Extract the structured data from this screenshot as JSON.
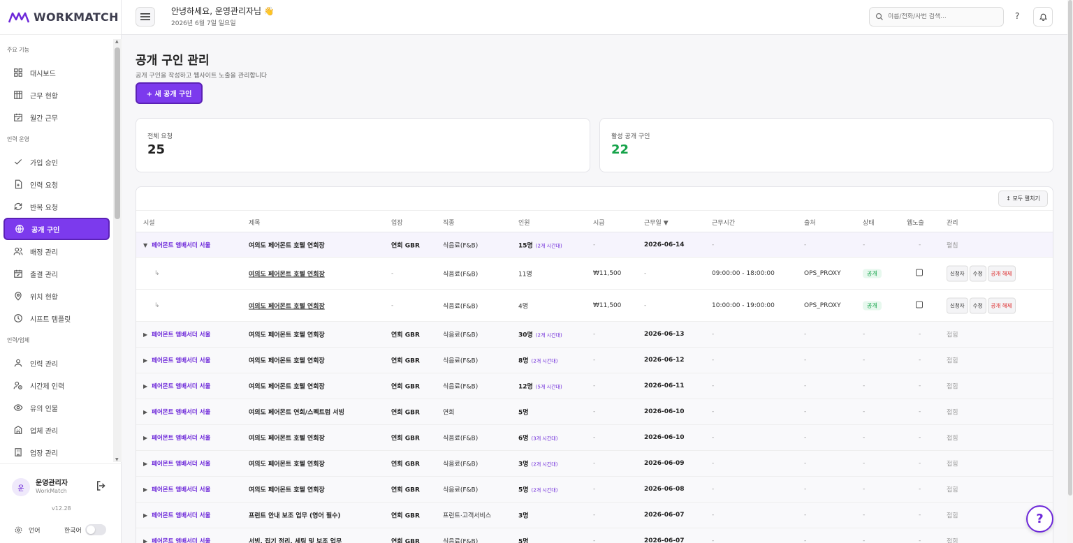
{
  "brand": {
    "logo_text": "WORKMATCH",
    "accent": "#7c3aed"
  },
  "sidebar": {
    "sections": [
      {
        "title": "주요 기능",
        "items": [
          {
            "label": "대시보드",
            "icon": "grid-icon"
          },
          {
            "label": "근무 현황",
            "icon": "table-icon"
          },
          {
            "label": "월간 근무",
            "icon": "calendar-check-icon"
          }
        ]
      },
      {
        "title": "인력 운영",
        "items": [
          {
            "label": "가입 승인",
            "icon": "check-icon"
          },
          {
            "label": "인력 요청",
            "icon": "file-plus-icon"
          },
          {
            "label": "반복 요청",
            "icon": "repeat-icon"
          },
          {
            "label": "공개 구인",
            "icon": "globe-icon",
            "active": true
          },
          {
            "label": "배정 관리",
            "icon": "users-icon"
          },
          {
            "label": "출결 관리",
            "icon": "calendar-check-icon"
          },
          {
            "label": "위치 현황",
            "icon": "map-pin-icon"
          },
          {
            "label": "시프트 템플릿",
            "icon": "clock-icon"
          }
        ]
      },
      {
        "title": "인력/업체",
        "items": [
          {
            "label": "인력 관리",
            "icon": "user-icon"
          },
          {
            "label": "시간제 인력",
            "icon": "user-clock-icon"
          },
          {
            "label": "유의 인물",
            "icon": "eye-icon"
          },
          {
            "label": "업체 관리",
            "icon": "building-icon"
          },
          {
            "label": "업장 관리",
            "icon": "store-icon"
          }
        ]
      }
    ],
    "user": {
      "avatar": "운",
      "name": "운영관리자",
      "org": "WorkMatch"
    },
    "version": "v12.28",
    "language_label": "언어",
    "language_value": "한국어"
  },
  "header": {
    "greeting": "안녕하세요, 운영관리자님 👋",
    "date": "2026년 6월 7일 일요일",
    "search_placeholder": "이름/전화/사번 검색...",
    "help": "?"
  },
  "page": {
    "title": "공개 구인 관리",
    "subtitle": "공개 구인을 작성하고 웹사이트 노출을 관리합니다",
    "new_button": "+ 새 공개 구인",
    "stats": [
      {
        "label": "전체 요청",
        "value": "25",
        "color": "#222222"
      },
      {
        "label": "활성 공개 구인",
        "value": "22",
        "color": "#16a34a"
      }
    ],
    "expand_all": "↕ 모두 펼치기"
  },
  "table": {
    "columns": [
      "시설",
      "제목",
      "업장",
      "직종",
      "인원",
      "시급",
      "근무일 ▼",
      "근무시간",
      "출처",
      "상태",
      "웹노출",
      "관리"
    ],
    "rows": [
      {
        "type": "group",
        "open": true,
        "caret": "▼",
        "facility": "페어몬트 앰배서더 서울",
        "title": "여의도 페어몬트 호텔 연회장",
        "venue": "연회 GBR",
        "job": "식음료(F&B)",
        "count": "15명",
        "slots": "(2개 시간대)",
        "wage": "-",
        "date": "2026-06-14",
        "time": "-",
        "source": "-",
        "status": "-",
        "web": "-",
        "manage": "펼침"
      },
      {
        "type": "child",
        "arrow": "↳",
        "title": "여의도 페어몬트 호텔 연회장",
        "venue": "-",
        "job": "식음료(F&B)",
        "count": "11명",
        "wage": "₩11,500",
        "date": "-",
        "time": "09:00:00 - 18:00:00",
        "source": "OPS_PROXY",
        "status": "공개",
        "actions": [
          "신청자",
          "수정",
          "공개 해제"
        ]
      },
      {
        "type": "child",
        "arrow": "↳",
        "title": "여의도 페어몬트 호텔 연회장",
        "venue": "-",
        "job": "식음료(F&B)",
        "count": "4명",
        "wage": "₩11,500",
        "date": "-",
        "time": "10:00:00 - 19:00:00",
        "source": "OPS_PROXY",
        "status": "공개",
        "actions": [
          "신청자",
          "수정",
          "공개 해제"
        ]
      },
      {
        "type": "group",
        "caret": "▶",
        "facility": "페어몬트 앰배서더 서울",
        "title": "여의도 페어몬트 호텔 연회장",
        "venue": "연회 GBR",
        "job": "식음료(F&B)",
        "count": "30명",
        "slots": "(2개 시간대)",
        "wage": "-",
        "date": "2026-06-13",
        "time": "-",
        "source": "-",
        "status": "-",
        "web": "-",
        "manage": "접힘"
      },
      {
        "type": "group",
        "caret": "▶",
        "facility": "페어몬트 앰배서더 서울",
        "title": "여의도 페어몬트 호텔 연회장",
        "venue": "연회 GBR",
        "job": "식음료(F&B)",
        "count": "8명",
        "slots": "(2개 시간대)",
        "wage": "-",
        "date": "2026-06-12",
        "time": "-",
        "source": "-",
        "status": "-",
        "web": "-",
        "manage": "접힘"
      },
      {
        "type": "group",
        "caret": "▶",
        "facility": "페어몬트 앰배서더 서울",
        "title": "여의도 페어몬트 호텔 연회장",
        "venue": "연회 GBR",
        "job": "식음료(F&B)",
        "count": "12명",
        "slots": "(5개 시간대)",
        "wage": "-",
        "date": "2026-06-11",
        "time": "-",
        "source": "-",
        "status": "-",
        "web": "-",
        "manage": "접힘"
      },
      {
        "type": "group",
        "caret": "▶",
        "facility": "페어몬트 앰배서더 서울",
        "title": "여의도 페어몬트 연회/스펙트럼 서빙",
        "venue": "연회 GBR",
        "job": "연회",
        "count": "5명",
        "slots": "",
        "wage": "-",
        "date": "2026-06-10",
        "time": "-",
        "source": "-",
        "status": "-",
        "web": "-",
        "manage": "접힘"
      },
      {
        "type": "group",
        "caret": "▶",
        "facility": "페어몬트 앰배서더 서울",
        "title": "여의도 페어몬트 호텔 연회장",
        "venue": "연회 GBR",
        "job": "식음료(F&B)",
        "count": "6명",
        "slots": "(3개 시간대)",
        "wage": "-",
        "date": "2026-06-10",
        "time": "-",
        "source": "-",
        "status": "-",
        "web": "-",
        "manage": "접힘"
      },
      {
        "type": "group",
        "caret": "▶",
        "facility": "페어몬트 앰배서더 서울",
        "title": "여의도 페어몬트 호텔 연회장",
        "venue": "연회 GBR",
        "job": "식음료(F&B)",
        "count": "3명",
        "slots": "(2개 시간대)",
        "wage": "-",
        "date": "2026-06-09",
        "time": "-",
        "source": "-",
        "status": "-",
        "web": "-",
        "manage": "접힘"
      },
      {
        "type": "group",
        "caret": "▶",
        "facility": "페어몬트 앰배서더 서울",
        "title": "여의도 페어몬트 호텔 연회장",
        "venue": "연회 GBR",
        "job": "식음료(F&B)",
        "count": "5명",
        "slots": "(2개 시간대)",
        "wage": "-",
        "date": "2026-06-08",
        "time": "-",
        "source": "-",
        "status": "-",
        "web": "-",
        "manage": "접힘"
      },
      {
        "type": "group",
        "caret": "▶",
        "facility": "페어몬트 앰배서더 서울",
        "title": "프런트 안내 보조 업무 (영어 필수)",
        "venue": "연회 GBR",
        "job": "프런트·고객서비스",
        "count": "3명",
        "slots": "",
        "wage": "-",
        "date": "2026-06-07",
        "time": "-",
        "source": "-",
        "status": "-",
        "web": "-",
        "manage": "접힘"
      },
      {
        "type": "group",
        "caret": "▶",
        "facility": "페어몬트 앰배서더 서울",
        "title": "서빙, 집기 정리, 세팅 및 보조 업무",
        "venue": "연회 GBR",
        "job": "식음료(F&B)",
        "count": "5명",
        "slots": "",
        "wage": "-",
        "date": "2026-06-07",
        "time": "-",
        "source": "-",
        "status": "-",
        "web": "-",
        "manage": "접힘"
      }
    ]
  },
  "fab": "?"
}
